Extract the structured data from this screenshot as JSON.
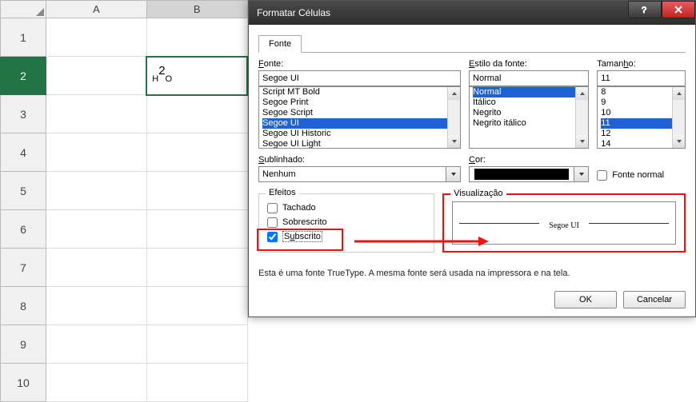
{
  "grid": {
    "columns": [
      "A",
      "B"
    ],
    "rows": [
      "1",
      "2",
      "3",
      "4",
      "5",
      "6",
      "7",
      "8",
      "9",
      "10"
    ],
    "selected_row": "2",
    "selected_col": "B",
    "cell_value_prefix": "H",
    "cell_value_sup": "2",
    "cell_value_suffix": "O"
  },
  "dialog": {
    "title": "Formatar Células",
    "tab": "Fonte",
    "font_label": "Fonte:",
    "font_value": "Segoe UI",
    "font_list": [
      "Script MT Bold",
      "Segoe Print",
      "Segoe Script",
      "Segoe UI",
      "Segoe UI Historic",
      "Segoe UI Light"
    ],
    "font_selected_index": 3,
    "style_label": "Estilo da fonte:",
    "style_value": "Normal",
    "style_list": [
      "Normal",
      "Itálico",
      "Negrito",
      "Negrito itálico"
    ],
    "style_selected_index": 0,
    "size_label": "Tamanho:",
    "size_value": "11",
    "size_list": [
      "8",
      "9",
      "10",
      "11",
      "12",
      "14"
    ],
    "size_selected_index": 3,
    "underline_label": "Sublinhado:",
    "underline_value": "Nenhum",
    "color_label": "Cor:",
    "normal_font_label": "Fonte normal",
    "effects_label": "Efeitos",
    "effect_strike": "Tachado",
    "effect_super": "Sobrescrito",
    "effect_sub": "Subscrito",
    "preview_label": "Visualização",
    "preview_text": "Segoe UI",
    "info_text": "Esta é uma fonte TrueType. A mesma fonte será usada na impressora e na tela.",
    "ok": "OK",
    "cancel": "Cancelar"
  }
}
